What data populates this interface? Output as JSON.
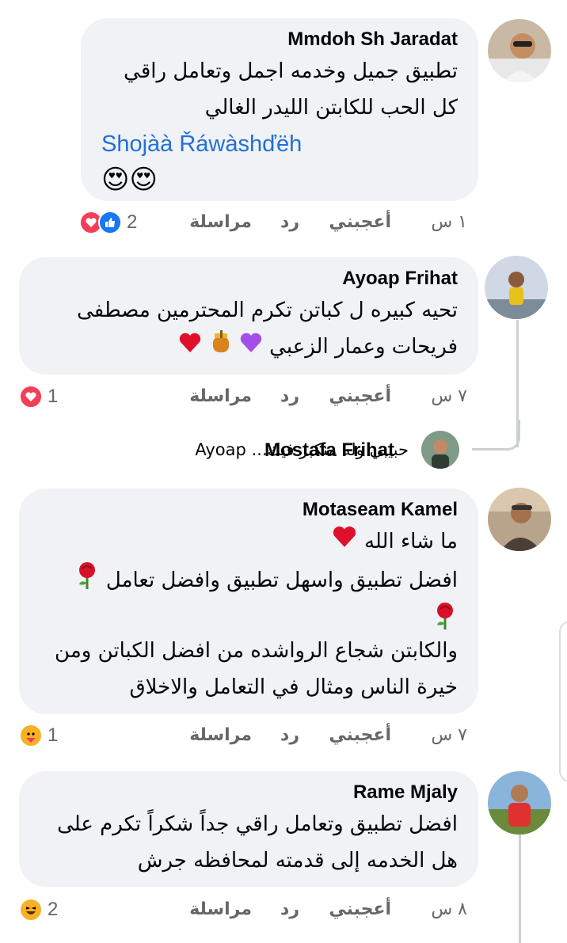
{
  "comments": [
    {
      "author": "Mmdoh Sh Jaradat",
      "lines": [
        "تطبيق جميل وخدمه اجمل وتعامل راقي",
        "كل الحب للكابتن الليدر الغالي"
      ],
      "mention": "Shojàà Řáwàshďëh",
      "emoji": "😍😍",
      "time": "١ س",
      "like_label": "أعجبني",
      "reply_label": "رد",
      "message_label": "مراسلة",
      "reaction_count": "2",
      "reactions": [
        "like-icon",
        "love-icon"
      ]
    },
    {
      "author": "Ayoap Frihat",
      "lines": [
        "تحيه كبيره ل كباتن تكرم المحترمين مصطفى",
        "فريحات وعمار الزعبي"
      ],
      "emoji_line2": [
        "purple-heart",
        "honey-pot",
        "red-heart"
      ],
      "time": "٧ س",
      "like_label": "أعجبني",
      "reply_label": "رد",
      "message_label": "مراسلة",
      "reaction_count": "1",
      "reactions": [
        "love-icon"
      ],
      "reply_preview": {
        "author": "Mostafa Frihat",
        "text": "حبيبي وله منكبر فيك... Ayoap"
      }
    },
    {
      "author": "Motaseam Kamel",
      "lines": [
        "ما شاء الله",
        "افضل تطبيق واسهل تطبيق وافضل تعامل",
        "",
        "والكابتن شجاع الرواشده من افضل الكباتن ومن",
        "خيرة الناس ومثال في التعامل والاخلاق"
      ],
      "time": "٧ س",
      "like_label": "أعجبني",
      "reply_label": "رد",
      "message_label": "مراسلة",
      "reaction_count": "1",
      "reactions": [
        "care-icon"
      ]
    },
    {
      "author": "Rame Mjaly",
      "lines": [
        "افضل تطبيق وتعامل راقي جداً شكراً تكرم على",
        "هل الخدمه إلى قدمته لمحافظه جرش"
      ],
      "time": "٨ س",
      "like_label": "أعجبني",
      "reply_label": "رد",
      "message_label": "مراسلة",
      "reaction_count": "2",
      "reactions": [
        "haha-icon"
      ]
    }
  ],
  "colors": {
    "bubble_bg": "#f0f2f5",
    "meta_text": "#65676b",
    "mention": "#216fdb",
    "like_blue": "#1877f2",
    "love_red": "#f33e58"
  }
}
